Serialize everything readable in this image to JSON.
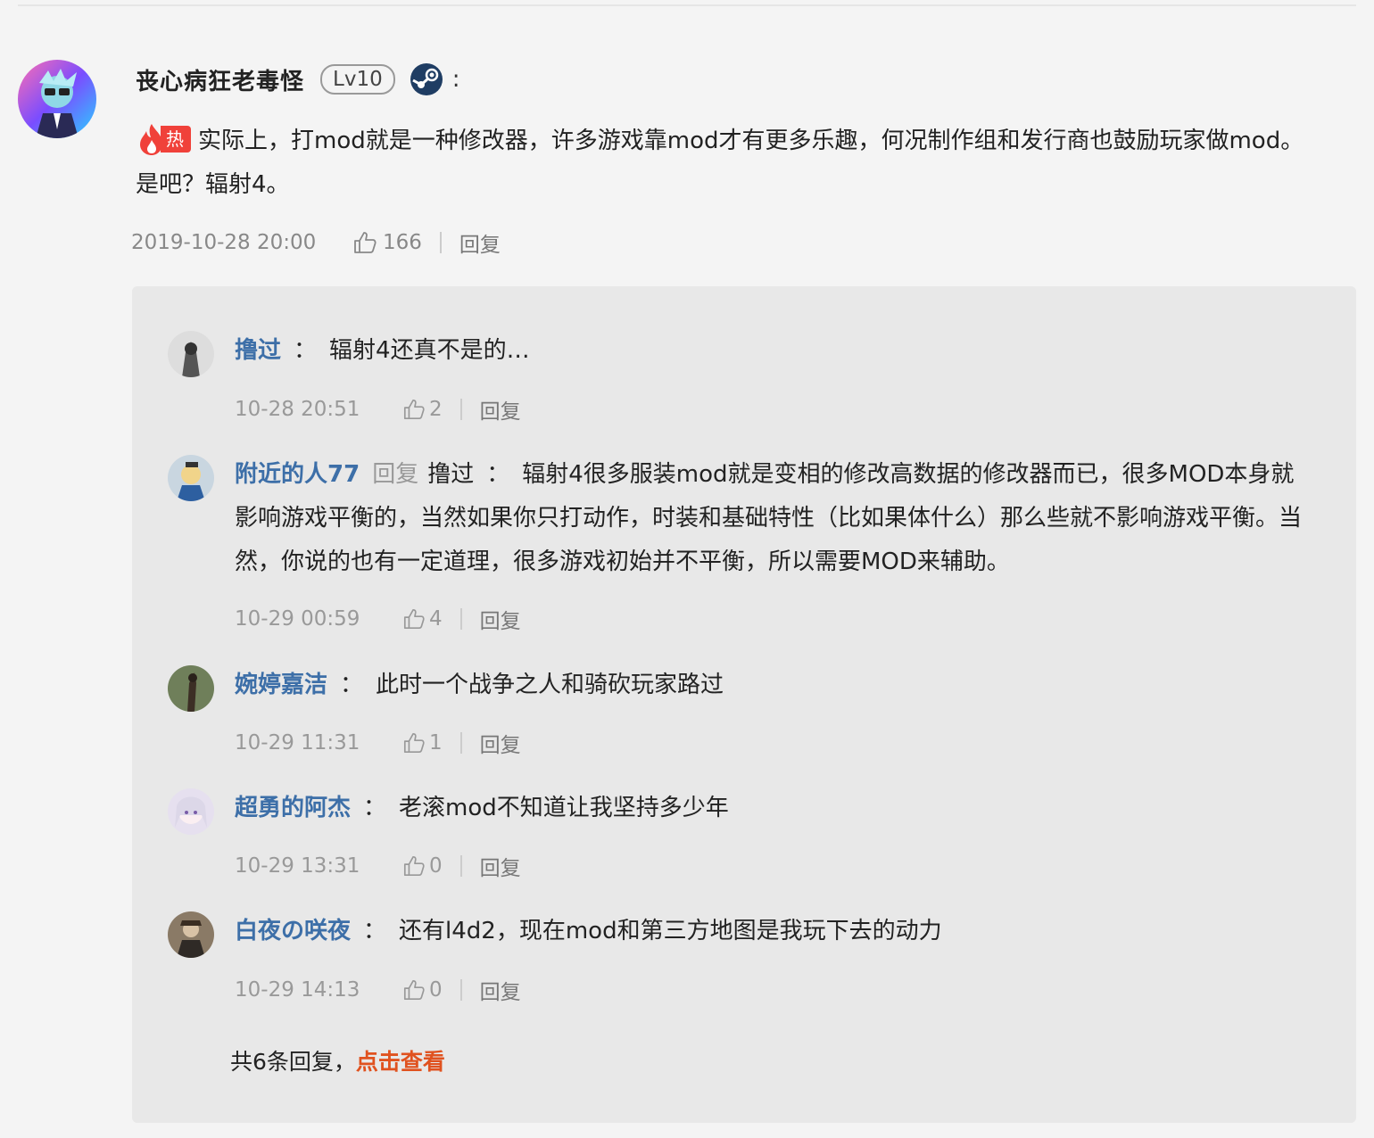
{
  "comment": {
    "author": "丧心病狂老毒怪",
    "level": "Lv10",
    "hot_label": "热",
    "content": "实际上，打mod就是一种修改器，许多游戏靠mod才有更多乐趣，何况制作组和发行商也鼓励玩家做mod。是吧？辐射4。",
    "time": "2019-10-28 20:00",
    "likes": "166",
    "reply_label": "回复",
    "colon": ":"
  },
  "replies": [
    {
      "name": "撸过",
      "reply_to": "",
      "text": "辐射4还真不是的…",
      "time": "10-28 20:51",
      "likes": "2"
    },
    {
      "name": "附近的人77",
      "reply_to": "撸过",
      "text": "辐射4很多服装mod就是变相的修改高数据的修改器而已，很多MOD本身就影响游戏平衡的，当然如果你只打动作，时装和基础特性（比如果体什么）那么些就不影响游戏平衡。当然，你说的也有一定道理，很多游戏初始并不平衡，所以需要MOD来辅助。",
      "time": "10-29 00:59",
      "likes": "4"
    },
    {
      "name": "婉婷嘉洁",
      "reply_to": "",
      "text": "此时一个战争之人和骑砍玩家路过",
      "time": "10-29 11:31",
      "likes": "1"
    },
    {
      "name": "超勇的阿杰",
      "reply_to": "",
      "text": "老滚mod不知道让我坚持多少年",
      "time": "10-29 13:31",
      "likes": "0"
    },
    {
      "name": "白夜の咲夜",
      "reply_to": "",
      "text": "还有l4d2，现在mod和第三方地图是我玩下去的动力",
      "time": "10-29 14:13",
      "likes": "0"
    }
  ],
  "labels": {
    "reply": "回复",
    "colon": "："
  },
  "footer": {
    "prefix": "共6条回复，",
    "link": "点击查看"
  }
}
